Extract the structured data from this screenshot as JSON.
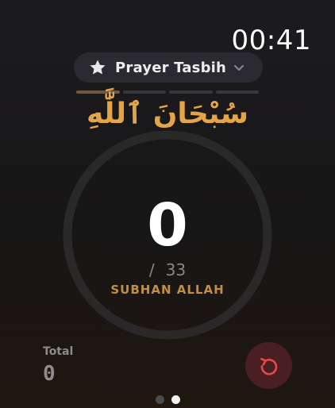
{
  "status": {
    "time": "00:41"
  },
  "picker": {
    "label": "Prayer Tasbih",
    "icon": "star-icon",
    "dropdown_icon": "chevron-down-icon"
  },
  "dhikr": {
    "arabic": "سُبْحَانَ ٱللَّٰهِ",
    "name": "SUBHAN ALLAH",
    "count": "0",
    "slash": "/",
    "target": "33",
    "progress": 0
  },
  "total": {
    "label": "Total",
    "value": "0"
  },
  "reset_button": {
    "icon": "reset-icon"
  },
  "pages": {
    "count": 2,
    "active_index": 1
  },
  "colors": {
    "accent": "#e4a448",
    "reset_bg": "#4a1f22",
    "reset_fg": "#e5484d"
  }
}
